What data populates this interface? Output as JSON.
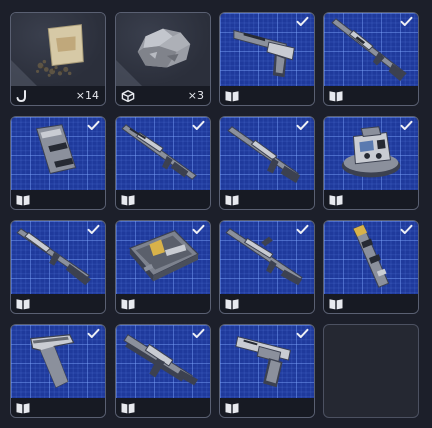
{
  "inventory": {
    "slots": [
      {
        "id": "slot-1",
        "item": "sand-bag",
        "kind": "material",
        "footer_icon": "hook-icon",
        "quantity": "×14",
        "learned": false
      },
      {
        "id": "slot-2",
        "item": "ore-chunk",
        "kind": "material",
        "footer_icon": "cube-icon",
        "quantity": "×3",
        "learned": false
      },
      {
        "id": "slot-3",
        "item": "heavy-pistol",
        "kind": "blueprint",
        "footer_icon": "open-book-icon",
        "quantity": "",
        "learned": true
      },
      {
        "id": "slot-4",
        "item": "marksman-rifle",
        "kind": "blueprint",
        "footer_icon": "open-book-icon",
        "quantity": "",
        "learned": true
      },
      {
        "id": "slot-5",
        "item": "suppressor",
        "kind": "blueprint",
        "footer_icon": "open-book-icon",
        "quantity": "",
        "learned": true
      },
      {
        "id": "slot-6",
        "item": "shotgun",
        "kind": "blueprint",
        "footer_icon": "open-book-icon",
        "quantity": "",
        "learned": true
      },
      {
        "id": "slot-7",
        "item": "carbine",
        "kind": "blueprint",
        "footer_icon": "open-book-icon",
        "quantity": "",
        "learned": true
      },
      {
        "id": "slot-8",
        "item": "turret-device",
        "kind": "blueprint",
        "footer_icon": "open-book-icon",
        "quantity": "",
        "learned": true
      },
      {
        "id": "slot-9",
        "item": "long-rifle",
        "kind": "blueprint",
        "footer_icon": "open-book-icon",
        "quantity": "",
        "learned": true
      },
      {
        "id": "slot-10",
        "item": "tool-case",
        "kind": "blueprint",
        "footer_icon": "open-book-icon",
        "quantity": "",
        "learned": true
      },
      {
        "id": "slot-11",
        "item": "sniper-rifle",
        "kind": "blueprint",
        "footer_icon": "open-book-icon",
        "quantity": "",
        "learned": true
      },
      {
        "id": "slot-12",
        "item": "barrel-part",
        "kind": "blueprint",
        "footer_icon": "open-book-icon",
        "quantity": "",
        "learned": true
      },
      {
        "id": "slot-13",
        "item": "rifle-stock",
        "kind": "blueprint",
        "footer_icon": "open-book-icon",
        "quantity": "",
        "learned": true
      },
      {
        "id": "slot-14",
        "item": "assault-rifle",
        "kind": "blueprint",
        "footer_icon": "open-book-icon",
        "quantity": "",
        "learned": true
      },
      {
        "id": "slot-15",
        "item": "revolver-pistol",
        "kind": "blueprint",
        "footer_icon": "open-book-icon",
        "quantity": "",
        "learned": true
      },
      {
        "id": "slot-16",
        "item": "",
        "kind": "empty",
        "footer_icon": "",
        "quantity": "",
        "learned": false
      }
    ]
  },
  "colors": {
    "background": "#1c1f2a",
    "blueprint_blue": "#1f3a9c",
    "border": "#5a6072",
    "footer": "#171a23",
    "text": "#e8eaef"
  }
}
